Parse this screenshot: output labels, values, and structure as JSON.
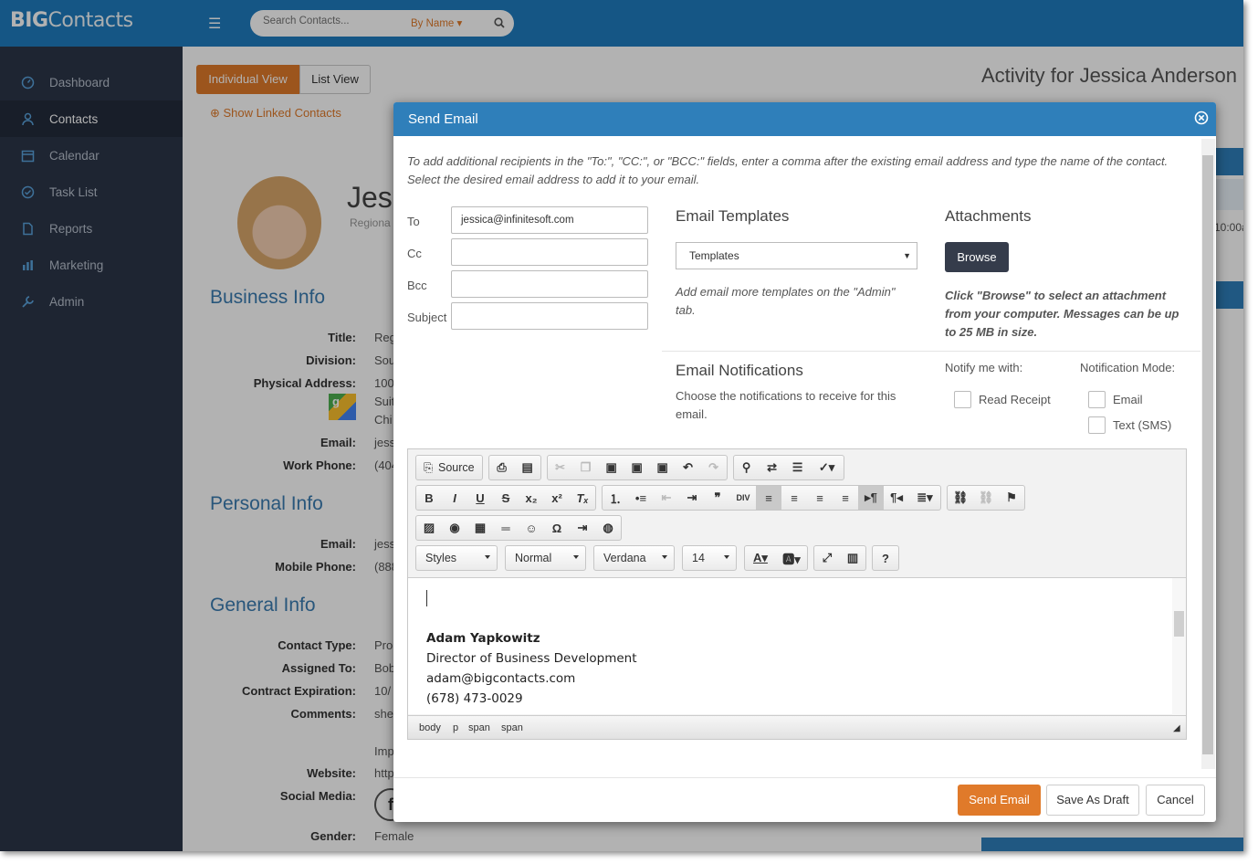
{
  "app": {
    "logo_main": "BIG",
    "logo_rest": "Contacts"
  },
  "search": {
    "placeholder": "Search Contacts...",
    "mode": "By Name"
  },
  "sidebar": {
    "items": [
      {
        "label": "Dashboard",
        "icon": "dashboard-icon"
      },
      {
        "label": "Contacts",
        "icon": "user-icon",
        "active": true
      },
      {
        "label": "Calendar",
        "icon": "calendar-icon"
      },
      {
        "label": "Task List",
        "icon": "check-circle-icon"
      },
      {
        "label": "Reports",
        "icon": "document-icon"
      },
      {
        "label": "Marketing",
        "icon": "bar-chart-icon"
      },
      {
        "label": "Admin",
        "icon": "wrench-icon"
      }
    ]
  },
  "view": {
    "individual": "Individual View",
    "list": "List View",
    "linked": "Show Linked Contacts",
    "activity_title": "Activity for Jessica Anderson"
  },
  "contact": {
    "name_partial": "Jes",
    "subtitle_partial": "Regiona",
    "business_heading": "Business Info",
    "business": [
      {
        "label": "Title:",
        "value": "Reg"
      },
      {
        "label": "Division:",
        "value": "Sou"
      },
      {
        "label": "Physical Address:",
        "value": "100"
      },
      {
        "label": "",
        "value": "Suit"
      },
      {
        "label": "",
        "value": "Chi"
      },
      {
        "label": "Email:",
        "value": "jess"
      },
      {
        "label": "Work Phone:",
        "value": "(404"
      }
    ],
    "personal_heading": "Personal Info",
    "personal": [
      {
        "label": "Email:",
        "value": "jess"
      },
      {
        "label": "Mobile Phone:",
        "value": "(888"
      }
    ],
    "general_heading": "General Info",
    "general": [
      {
        "label": "Contact Type:",
        "value": "Pro"
      },
      {
        "label": "Assigned To:",
        "value": "Bob"
      },
      {
        "label": "Contract Expiration:",
        "value": "10/"
      },
      {
        "label": "Comments:",
        "value": "she"
      },
      {
        "label": "",
        "value": "Imp"
      },
      {
        "label": "Website:",
        "value": "http"
      },
      {
        "label": "Social Media:",
        "value": ""
      },
      {
        "label": "Gender:",
        "value": "Female"
      }
    ],
    "social_letter": "f"
  },
  "modal": {
    "title": "Send Email",
    "intro": "To add additional recipients in the \"To:\", \"CC:\", or \"BCC:\" fields, enter a comma after the existing email address and type the name of the contact. Select the desired email address to add it to your email.",
    "to_label": "To",
    "to_value": "jessica@infinitesoft.com",
    "cc_label": "Cc",
    "bcc_label": "Bcc",
    "subject_label": "Subject",
    "templates_heading": "Email Templates",
    "templates_select": "Templates",
    "templates_note": "Add email more templates on the \"Admin\" tab.",
    "attachments_heading": "Attachments",
    "browse": "Browse",
    "attach_note": "Click \"Browse\" to select an attachment from your computer. Messages can be up to 25 MB in size.",
    "notif_heading": "Email Notifications",
    "notif_desc": "Choose the notifications to receive for this email.",
    "notify_with": "Notify me with:",
    "read_receipt": "Read Receipt",
    "notif_mode": "Notification Mode:",
    "mode_email": "Email",
    "mode_sms": "Text (SMS)",
    "send": "Send Email",
    "draft": "Save As Draft",
    "cancel": "Cancel"
  },
  "editor": {
    "source": "Source",
    "styles": "Styles",
    "format": "Normal",
    "font": "Verdana",
    "size": "14",
    "signature": {
      "name": "Adam Yapkowitz",
      "title": "Director of Business Development",
      "email": "adam@bigcontacts.com",
      "phone": "(678) 473-0029"
    },
    "path": [
      "body",
      "p",
      "span",
      "span"
    ]
  },
  "right_partial": {
    "time": "10:00a"
  },
  "colors": {
    "brand_blue": "#1f7bbf",
    "accent_orange": "#e07a2a",
    "sidebar": "#2c3548"
  }
}
